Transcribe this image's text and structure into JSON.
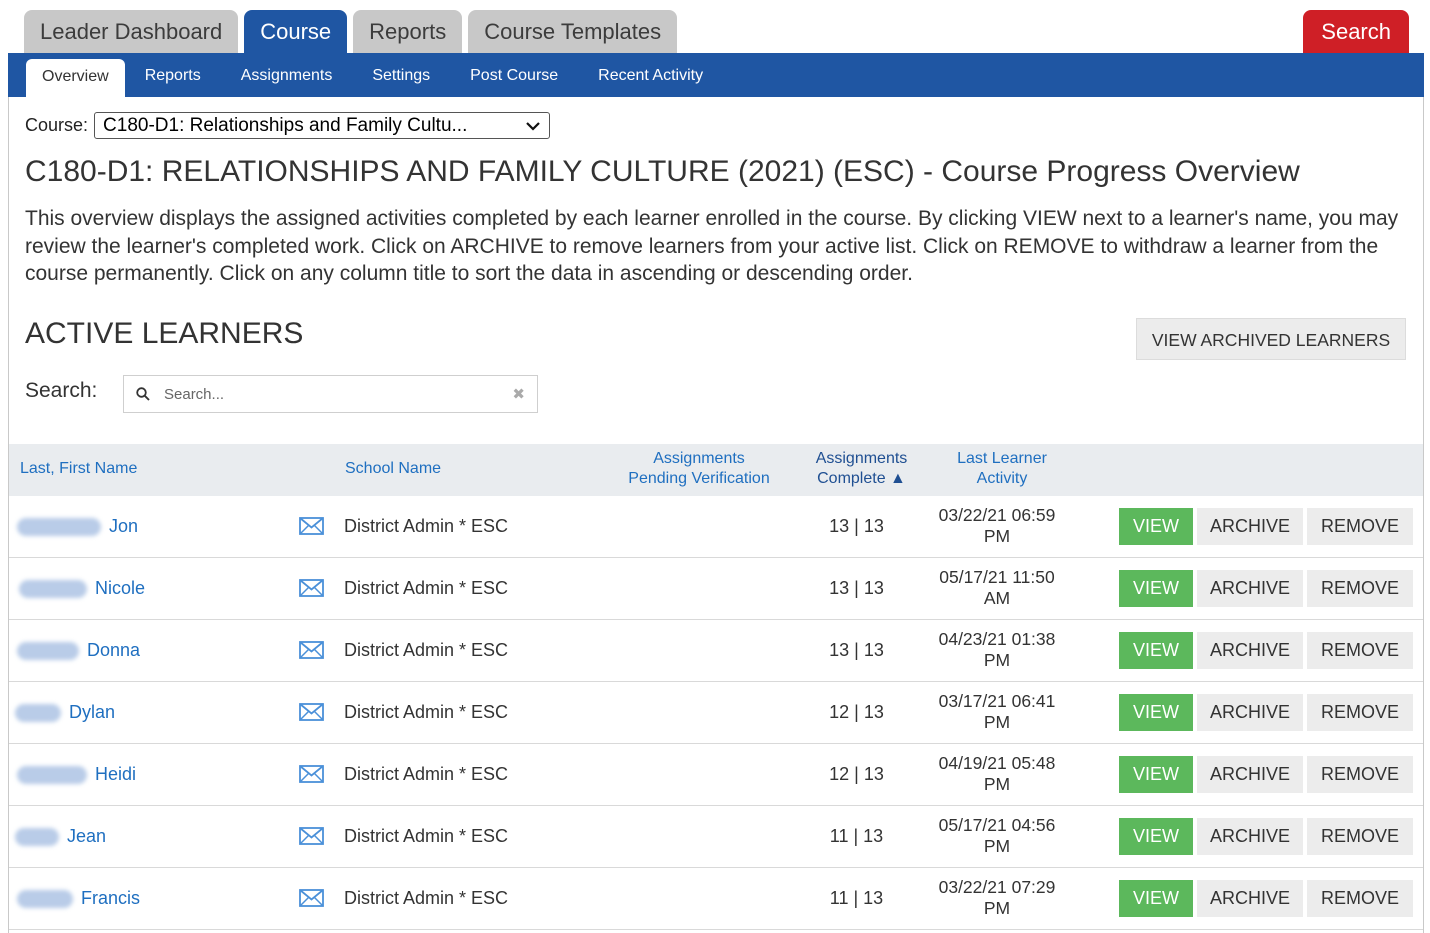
{
  "top_tabs": [
    "Leader Dashboard",
    "Course",
    "Reports",
    "Course Templates"
  ],
  "top_search_label": "Search",
  "sub_tabs": [
    "Overview",
    "Reports",
    "Assignments",
    "Settings",
    "Post Course",
    "Recent Activity"
  ],
  "course": {
    "label": "Course:",
    "selected": "C180-D1: Relationships and Family Cultu..."
  },
  "page_title": "C180-D1: RELATIONSHIPS AND FAMILY CULTURE (2021) (ESC) - Course Progress Overview",
  "intro": "This overview displays the assigned activities completed by each learner enrolled in the course. By clicking VIEW next to a learner's name, you may review the learner's completed work. Click on ARCHIVE to remove learners from your active list. Click on REMOVE to withdraw a learner from the course permanently. Click on any column title to sort the data in ascending or descending order.",
  "section_title": "ACTIVE LEARNERS",
  "archived_button": "VIEW ARCHIVED LEARNERS",
  "search": {
    "label": "Search:",
    "placeholder": "Search..."
  },
  "columns": {
    "name": "Last, First Name",
    "school": "School Name",
    "pending_1": "Assignments",
    "pending_2": "Pending Verification",
    "complete_1": "Assignments",
    "complete_2": "Complete ▲",
    "activity_1": "Last Learner",
    "activity_2": "Activity"
  },
  "actions": {
    "view": "VIEW",
    "archive": "ARCHIVE",
    "remove": "REMOVE"
  },
  "colors": {
    "nav_blue": "#1f56a3",
    "search_red": "#cf1f26",
    "view_green": "#5cb85c",
    "link_blue": "#1f6fc0"
  },
  "learners": [
    {
      "first": "Jon",
      "school": "District Admin * ESC",
      "complete": "13 | 13",
      "activity_1": "03/22/21 06:59",
      "activity_2": "PM"
    },
    {
      "first": "Nicole",
      "school": "District Admin * ESC",
      "complete": "13 | 13",
      "activity_1": "05/17/21 11:50",
      "activity_2": "AM"
    },
    {
      "first": "Donna",
      "school": "District Admin * ESC",
      "complete": "13 | 13",
      "activity_1": "04/23/21 01:38",
      "activity_2": "PM"
    },
    {
      "first": "Dylan",
      "school": "District Admin * ESC",
      "complete": "12 | 13",
      "activity_1": "03/17/21 06:41",
      "activity_2": "PM"
    },
    {
      "first": "Heidi",
      "school": "District Admin * ESC",
      "complete": "12 | 13",
      "activity_1": "04/19/21 05:48",
      "activity_2": "PM"
    },
    {
      "first": "Jean",
      "school": "District Admin * ESC",
      "complete": "11 | 13",
      "activity_1": "05/17/21 04:56",
      "activity_2": "PM"
    },
    {
      "first": "Francis",
      "school": "District Admin * ESC",
      "complete": "11 | 13",
      "activity_1": "03/22/21 07:29",
      "activity_2": "PM"
    }
  ]
}
